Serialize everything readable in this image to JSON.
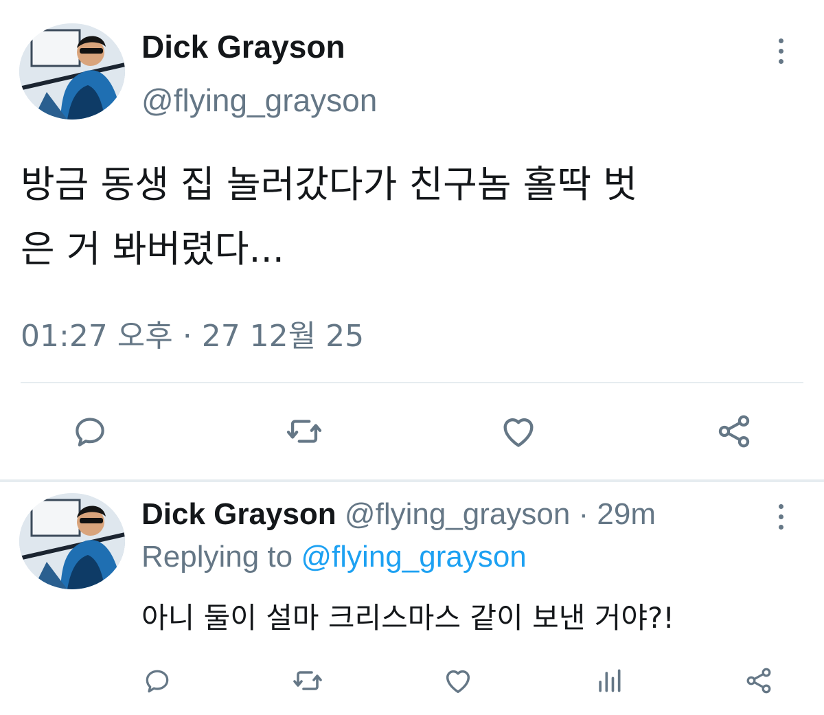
{
  "tweet": {
    "author_name": "Dick Grayson",
    "author_handle": "@flying_grayson",
    "text_line1": "방금 동생 집 놀러갔다가 친구놈 홀딱 벗",
    "text_line2": "은 거 봐버렸다...",
    "timestamp": "01:27 오후 · 27 12월 25",
    "actions": [
      "reply-icon",
      "retweet-icon",
      "like-icon",
      "share-icon"
    ]
  },
  "reply": {
    "author_name": "Dick Grayson",
    "author_handle": "@flying_grayson",
    "time": "· 29m",
    "replying_prefix": "Replying to",
    "replying_handle": "@flying_grayson",
    "text": "아니 둘이 설마 크리스마스 같이 보낸 거야?!",
    "actions": [
      "reply-icon",
      "retweet-icon",
      "like-icon",
      "analytics-icon",
      "share-icon"
    ]
  },
  "colors": {
    "text": "#14171a",
    "muted": "#657786",
    "link": "#1da1f2",
    "divider": "#e6ecf0"
  }
}
